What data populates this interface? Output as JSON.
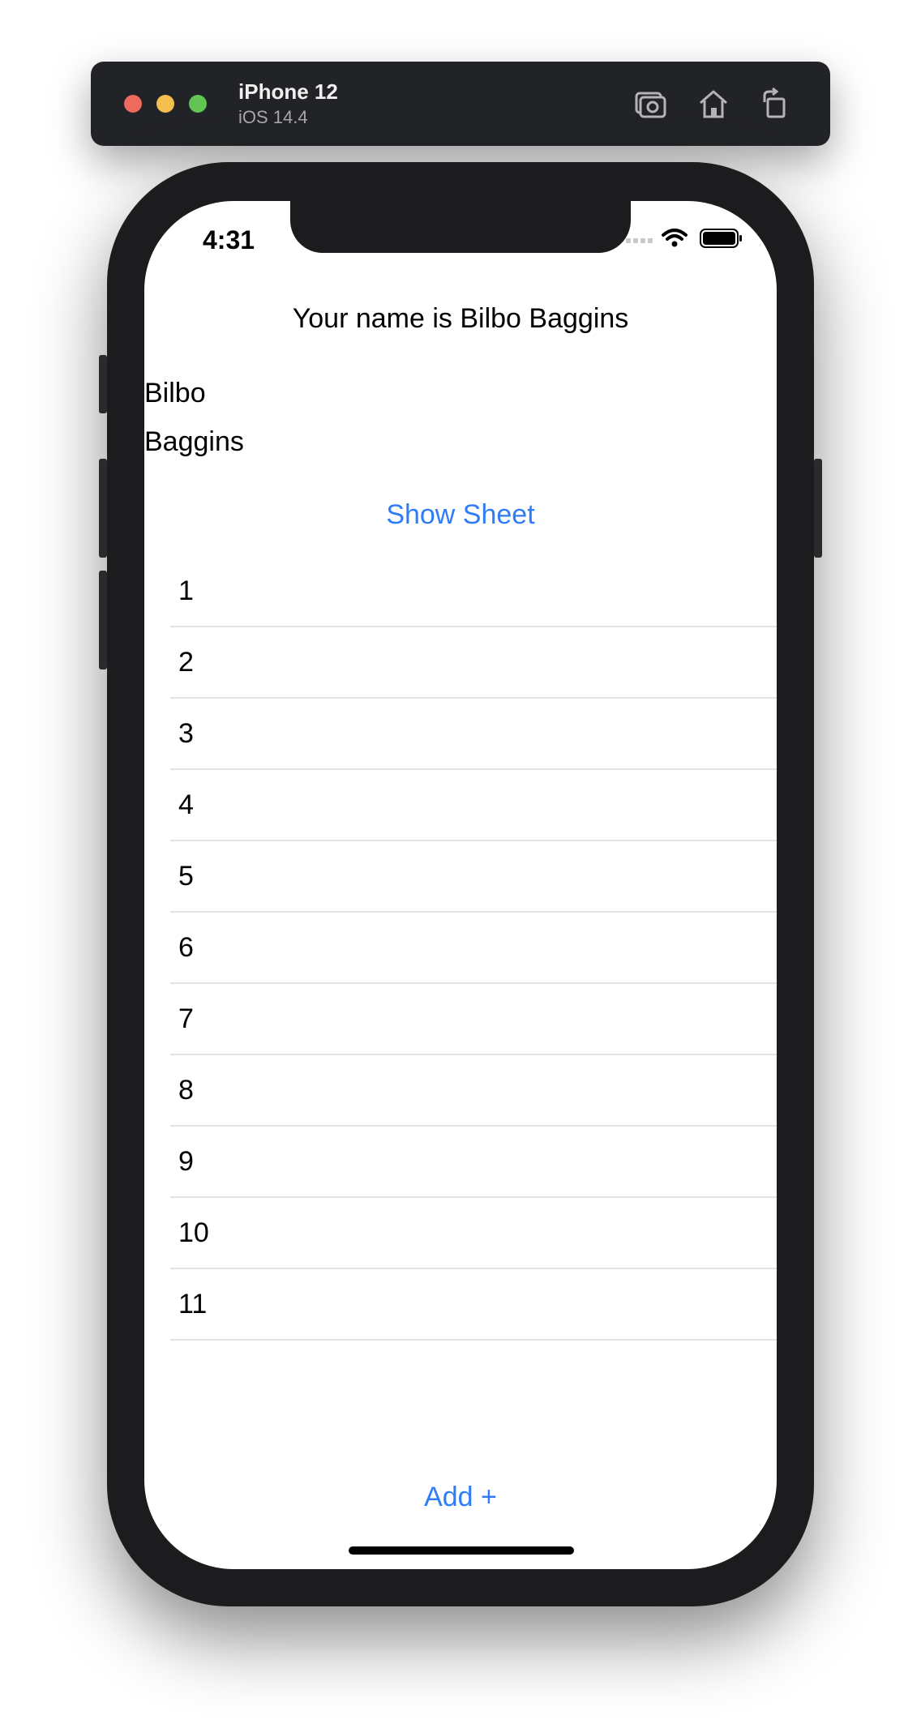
{
  "simulator": {
    "device_name": "iPhone 12",
    "os_version": "iOS 14.4",
    "icons": [
      "screenshot-icon",
      "home-icon",
      "rotate-icon"
    ]
  },
  "status_bar": {
    "time": "4:31",
    "icons": [
      "cellular-icon",
      "wifi-icon",
      "battery-icon"
    ]
  },
  "content": {
    "headline": "Your name is Bilbo Baggins",
    "first_name": "Bilbo",
    "last_name": "Baggins",
    "show_sheet_label": "Show Sheet",
    "list_items": [
      "1",
      "2",
      "3",
      "4",
      "5",
      "6",
      "7",
      "8",
      "9",
      "10",
      "11"
    ],
    "add_label": "Add +"
  },
  "colors": {
    "accent": "#2f7cf6",
    "device_frame": "#1c1c1e",
    "toolbar": "#222326"
  }
}
